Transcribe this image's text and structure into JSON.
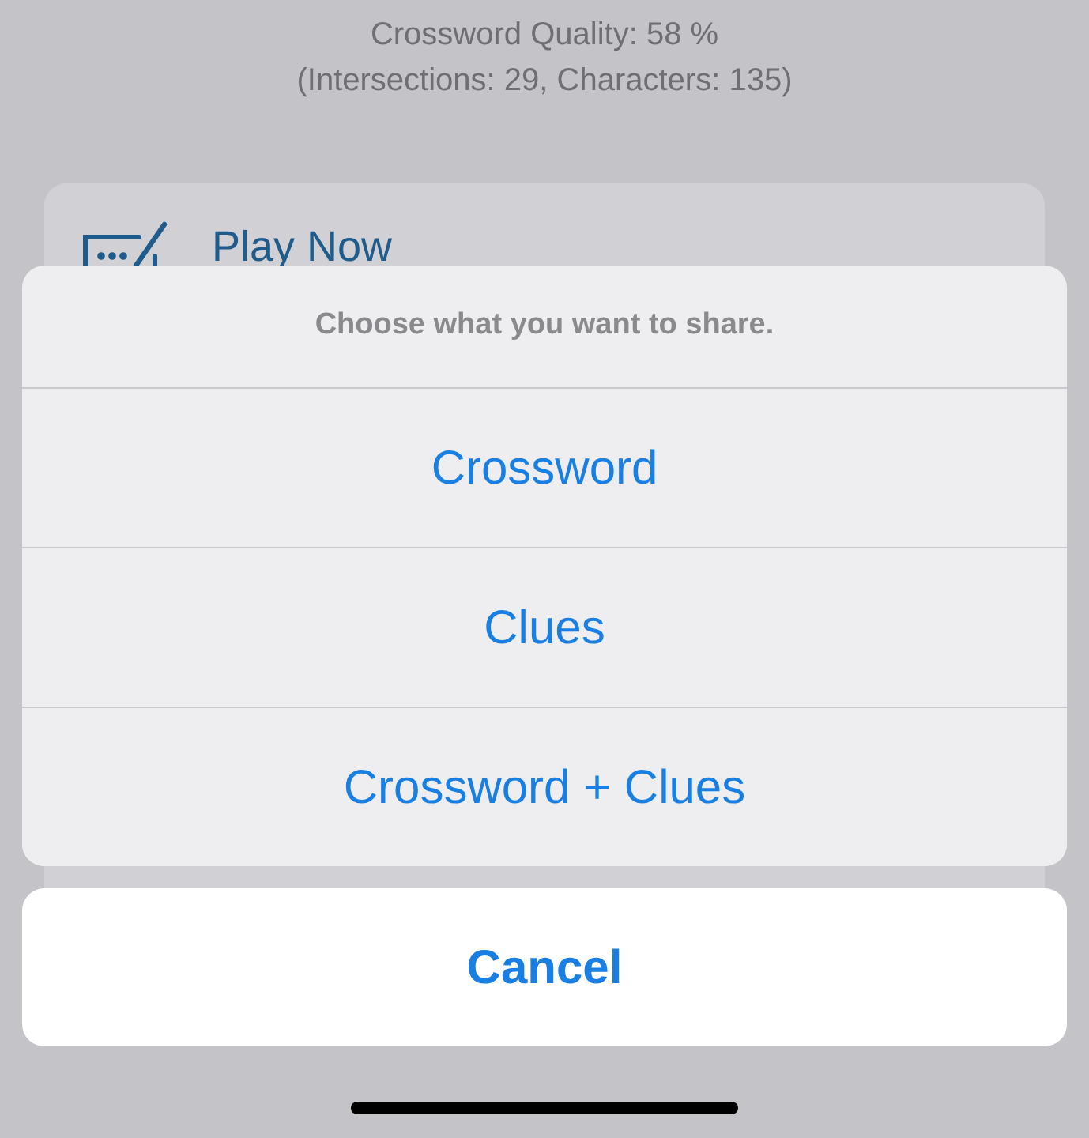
{
  "header": {
    "quality": "Crossword Quality: 58 %",
    "stats": "(Intersections: 29, Characters: 135)"
  },
  "menu": {
    "items": [
      {
        "label": "Play Now"
      }
    ]
  },
  "action_sheet": {
    "title": "Choose what you want to share.",
    "actions": [
      "Crossword",
      "Clues",
      "Crossword + Clues"
    ],
    "cancel": "Cancel"
  }
}
